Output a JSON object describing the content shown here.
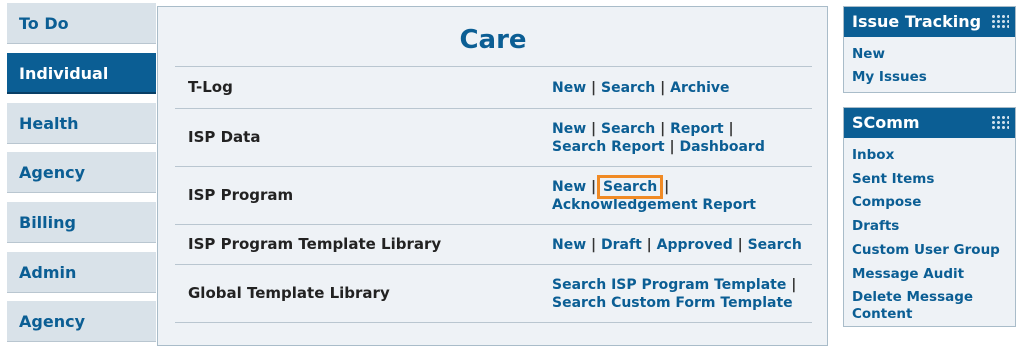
{
  "left_nav": {
    "items": [
      {
        "label": "To Do",
        "active": false
      },
      {
        "label": "Individual",
        "active": true
      },
      {
        "label": "Health",
        "active": false
      },
      {
        "label": "Agency",
        "active": false
      },
      {
        "label": "Billing",
        "active": false
      },
      {
        "label": "Admin",
        "active": false
      },
      {
        "label": "Agency",
        "active": false
      }
    ]
  },
  "main": {
    "title": "Care",
    "rows": [
      {
        "label": "T-Log",
        "links": [
          "New",
          "Search",
          "Archive"
        ]
      },
      {
        "label": "ISP Data",
        "links": [
          "New",
          "Search",
          "Report",
          "Search Report",
          "Dashboard"
        ]
      },
      {
        "label": "ISP Program",
        "links": [
          "New",
          "Search",
          "Acknowledgement Report"
        ],
        "highlighted": "Search"
      },
      {
        "label": "ISP Program Template Library",
        "links": [
          "New",
          "Draft",
          "Approved",
          "Search"
        ]
      },
      {
        "label": "Global Template Library",
        "links": [
          "Search ISP Program Template",
          "Search Custom Form Template"
        ]
      }
    ]
  },
  "separator": "|",
  "issue_tracking": {
    "title": "Issue Tracking",
    "links": [
      "New",
      "My Issues"
    ]
  },
  "scomm": {
    "title": "SComm",
    "links": [
      "Inbox",
      "Sent Items",
      "Compose",
      "Drafts",
      "Custom User Group",
      "Message Audit",
      "Delete Message Content"
    ]
  },
  "colors": {
    "accent": "#0b5e94",
    "highlight": "#f08a24",
    "panel_bg": "#eef2f6",
    "nav_bg": "#d9e2e9"
  }
}
